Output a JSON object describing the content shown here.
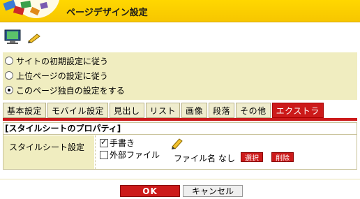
{
  "window": {
    "title": "ページデザイン設定"
  },
  "inherit_options": [
    {
      "label": "サイトの初期設定に従う",
      "checked": false
    },
    {
      "label": "上位ページの設定に従う",
      "checked": false
    },
    {
      "label": "このページ独自の設定をする",
      "checked": true
    }
  ],
  "tabs": [
    {
      "label": "基本設定",
      "active": false
    },
    {
      "label": "モバイル設定",
      "active": false
    },
    {
      "label": "見出し",
      "active": false
    },
    {
      "label": "リスト",
      "active": false
    },
    {
      "label": "画像",
      "active": false
    },
    {
      "label": "段落",
      "active": false
    },
    {
      "label": "その他",
      "active": false
    },
    {
      "label": "エクストラ",
      "active": true
    }
  ],
  "stylesheet": {
    "section_title": "[スタイルシートのプロパティ]",
    "field_label": "スタイルシート設定",
    "handwritten_label": "手書き",
    "handwritten_checked": true,
    "external_label": "外部ファイル",
    "external_checked": false,
    "file_name_label": "ファイル名",
    "file_name_value": "なし",
    "select_label": "選択",
    "delete_label": "削除"
  },
  "footer": {
    "ok_label": "OK",
    "cancel_label": "キャンセル"
  },
  "colors": {
    "accent": "#cc1a1a",
    "title_bar": "#ffd700",
    "panel": "#f0edc0"
  },
  "icons": [
    "logo-icon",
    "monitor-icon",
    "pencil-icon"
  ]
}
